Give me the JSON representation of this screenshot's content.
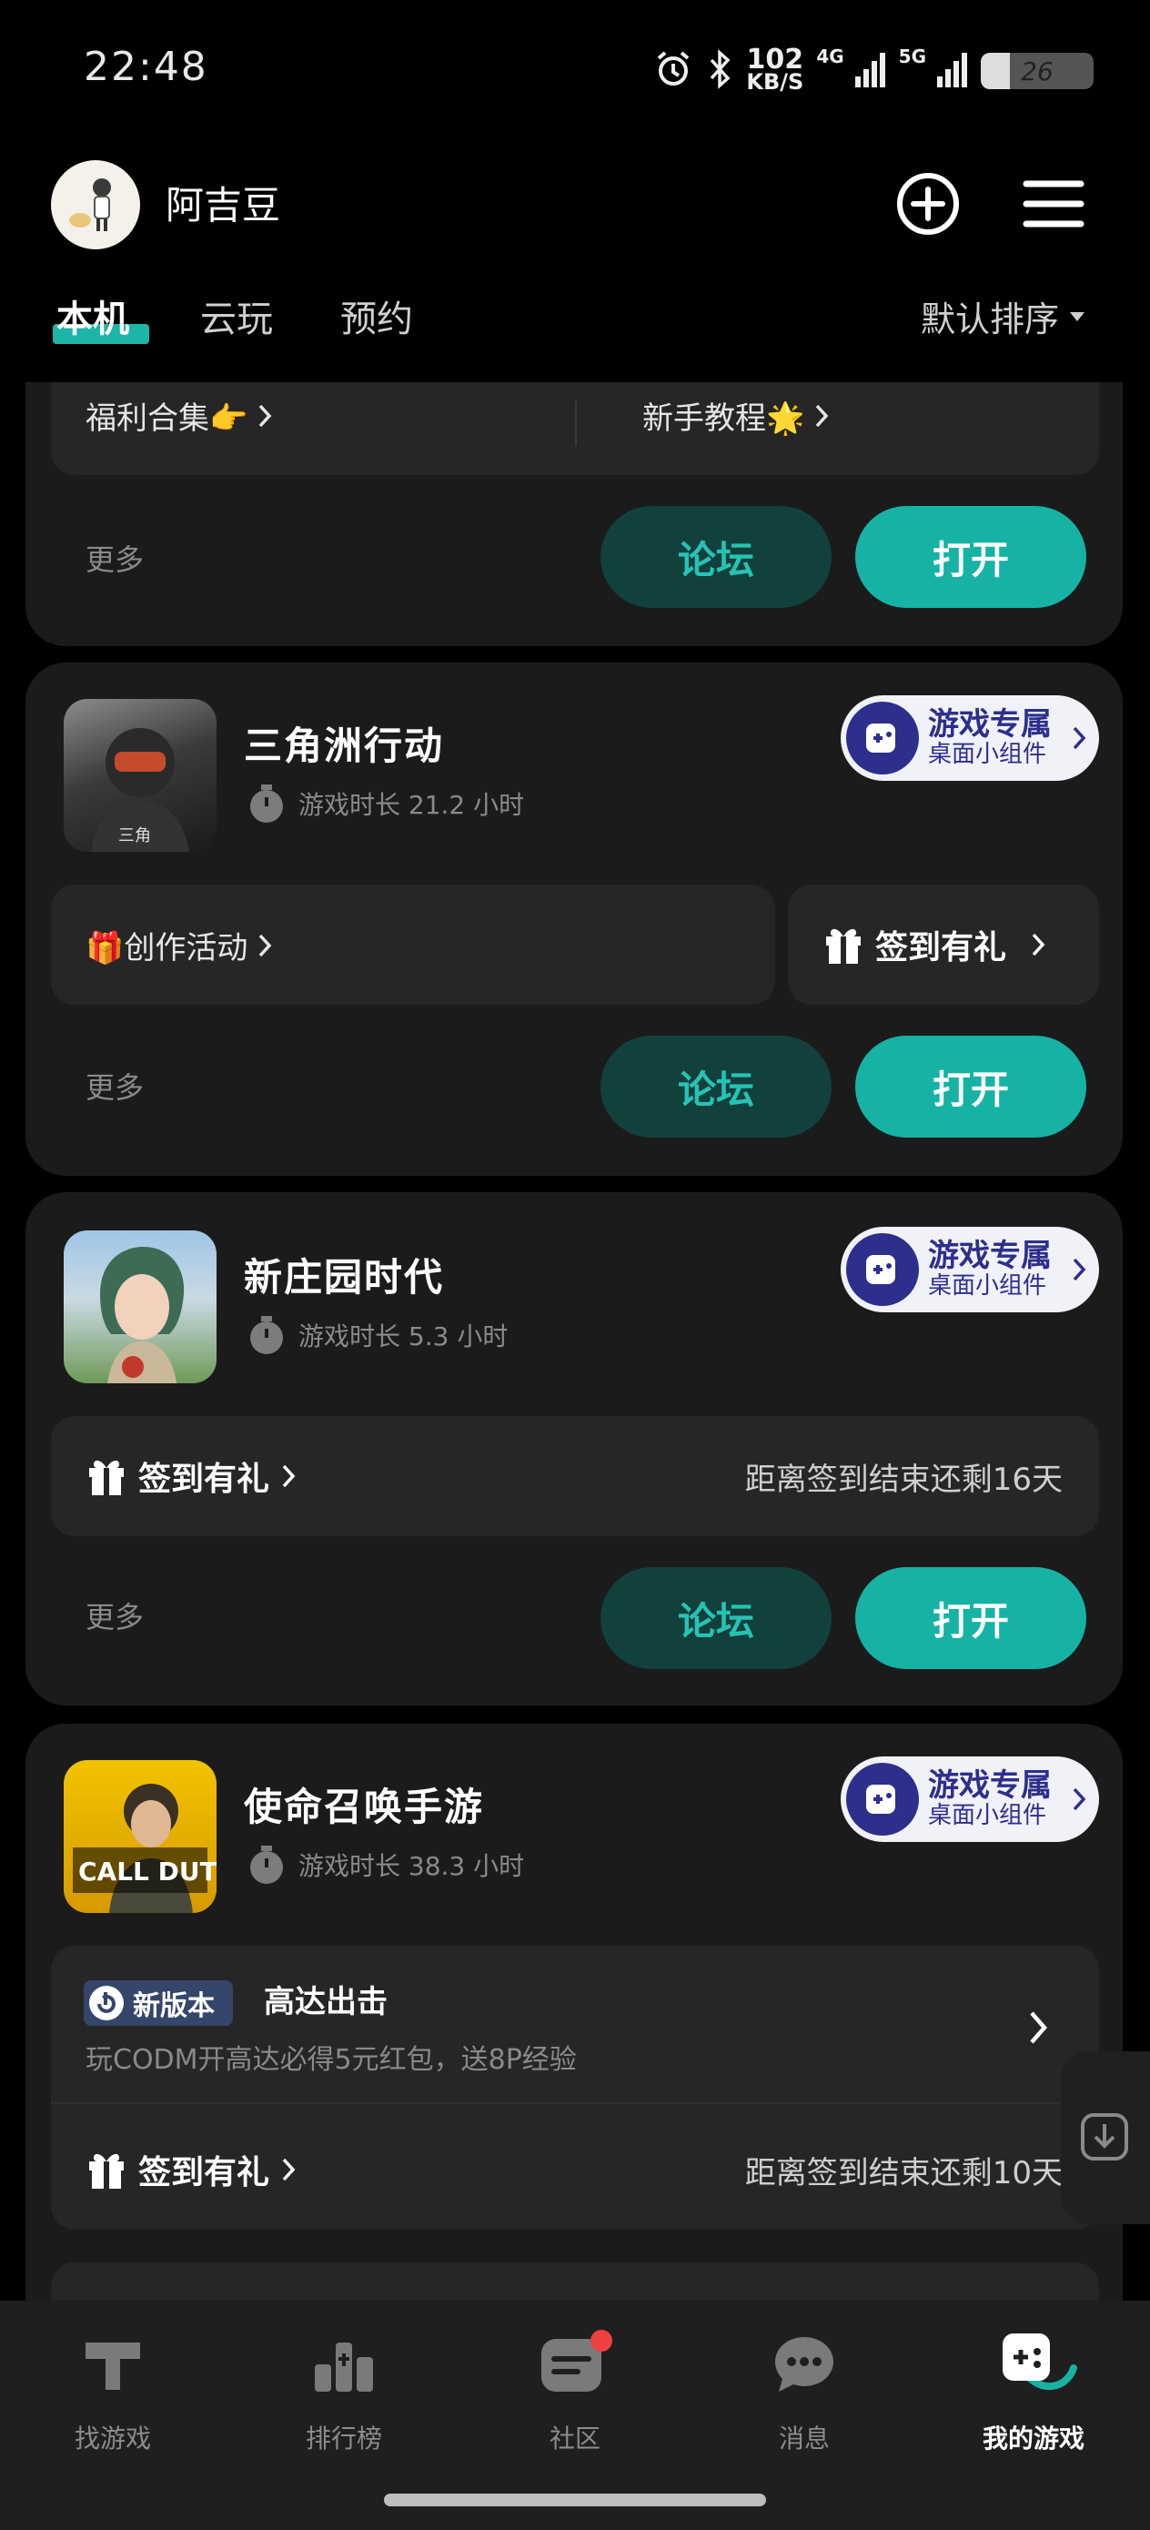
{
  "status_bar": {
    "time": "22:48",
    "net_speed_value": "102",
    "net_speed_unit": "KB/S",
    "sig1": "4G",
    "sig2": "5G",
    "battery": "26"
  },
  "header": {
    "username": "阿吉豆"
  },
  "tabs": [
    {
      "label": "本机"
    },
    {
      "label": "云玩"
    },
    {
      "label": "预约"
    }
  ],
  "sort_label": "默认排序",
  "card0": {
    "link1": "福利合集👉",
    "link2": "新手教程🌟",
    "more": "更多",
    "forum": "论坛",
    "open": "打开"
  },
  "games": [
    {
      "title": "三角洲行动",
      "playtime": "游戏时长 21.2 小时",
      "widget_line1": "游戏专属",
      "widget_line2": "桌面小组件",
      "activity": "🎁创作活动",
      "checkin": "签到有礼",
      "more": "更多",
      "forum": "论坛",
      "open": "打开"
    },
    {
      "title": "新庄园时代",
      "playtime": "游戏时长 5.3 小时",
      "widget_line1": "游戏专属",
      "widget_line2": "桌面小组件",
      "checkin": "签到有礼",
      "checkin_remaining": "距离签到结束还剩16天",
      "more": "更多",
      "forum": "论坛",
      "open": "打开"
    },
    {
      "title": "使命召唤手游",
      "playtime": "游戏时长 38.3 小时",
      "widget_line1": "游戏专属",
      "widget_line2": "桌面小组件",
      "new_version_badge": "新版本",
      "new_version_title": "高达出击",
      "new_version_desc": "玩CODM开高达必得5元红包，送8P经验",
      "checkin": "签到有礼",
      "checkin_remaining": "距离签到结束还剩10天",
      "icon_text": "CALL DUTY"
    }
  ],
  "bottom_nav": [
    {
      "label": "找游戏",
      "icon": "find-games-icon"
    },
    {
      "label": "排行榜",
      "icon": "leaderboard-icon"
    },
    {
      "label": "社区",
      "icon": "community-icon"
    },
    {
      "label": "消息",
      "icon": "message-icon"
    },
    {
      "label": "我的游戏",
      "icon": "my-games-icon"
    }
  ],
  "colors": {
    "accent": "#16b3a5",
    "forum_bg": "#12403d",
    "card_bg": "#1b1b1b",
    "widget_blue": "#2c2f8c"
  }
}
